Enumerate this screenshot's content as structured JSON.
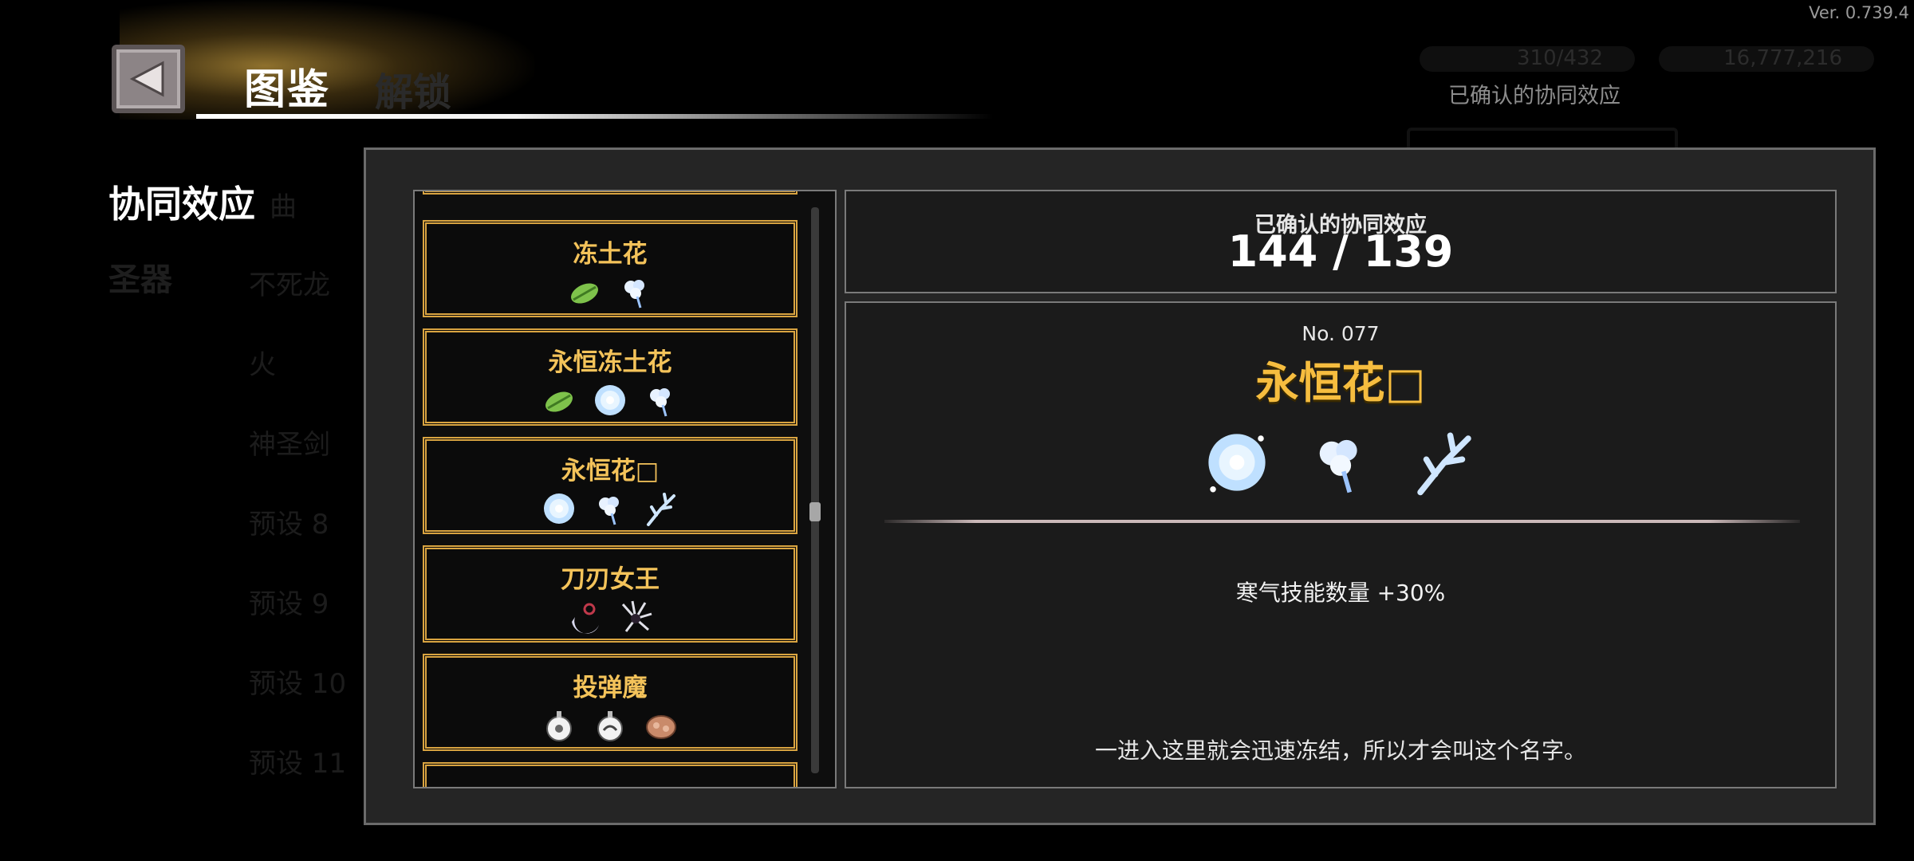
{
  "version": "Ver. 0.739.4",
  "header": {
    "title": "图鉴",
    "bg_tab": "解锁"
  },
  "categories": {
    "active": "协同效应",
    "other": "圣器"
  },
  "background_list": {
    "curve": "曲",
    "items": [
      "不死龙",
      "火",
      "神圣剑",
      "预设 8",
      "预设 9",
      "预设 10",
      "预设 11"
    ]
  },
  "background_top": {
    "counter1": "310/432",
    "counter2": "16,777,216",
    "confirmed_label": "已确认的协同效应"
  },
  "synergy_list": [
    {
      "name": "冻土花",
      "icons": [
        "leaf-icon",
        "flower-icon"
      ]
    },
    {
      "name": "永恒冻土花",
      "icons": [
        "leaf-icon",
        "frost-bloom-icon",
        "flower-icon"
      ]
    },
    {
      "name": "永恒花□",
      "icons": [
        "frost-bloom-icon",
        "flower-icon",
        "ice-branch-icon"
      ]
    },
    {
      "name": "刀刃女王",
      "icons": [
        "crescent-blade-icon",
        "dark-claw-icon"
      ]
    },
    {
      "name": "投弹魔",
      "icons": [
        "bomb-icon",
        "bomb-icon",
        "sack-icon"
      ]
    }
  ],
  "counter_box": {
    "label": "已确认的协同效应",
    "value": "144 / 139"
  },
  "detail": {
    "number": "No. 077",
    "name": "永恒花□",
    "icons": [
      "frost-bloom-icon",
      "flower-icon",
      "ice-branch-icon"
    ],
    "effect": "寒气技能数量 +30%",
    "description": "一进入这里就会迅速冻结，所以才会叫这个名字。"
  },
  "colors": {
    "accent_gold": "#f4c35a",
    "item_border": "#d9a441",
    "panel_bg": "#252525"
  }
}
